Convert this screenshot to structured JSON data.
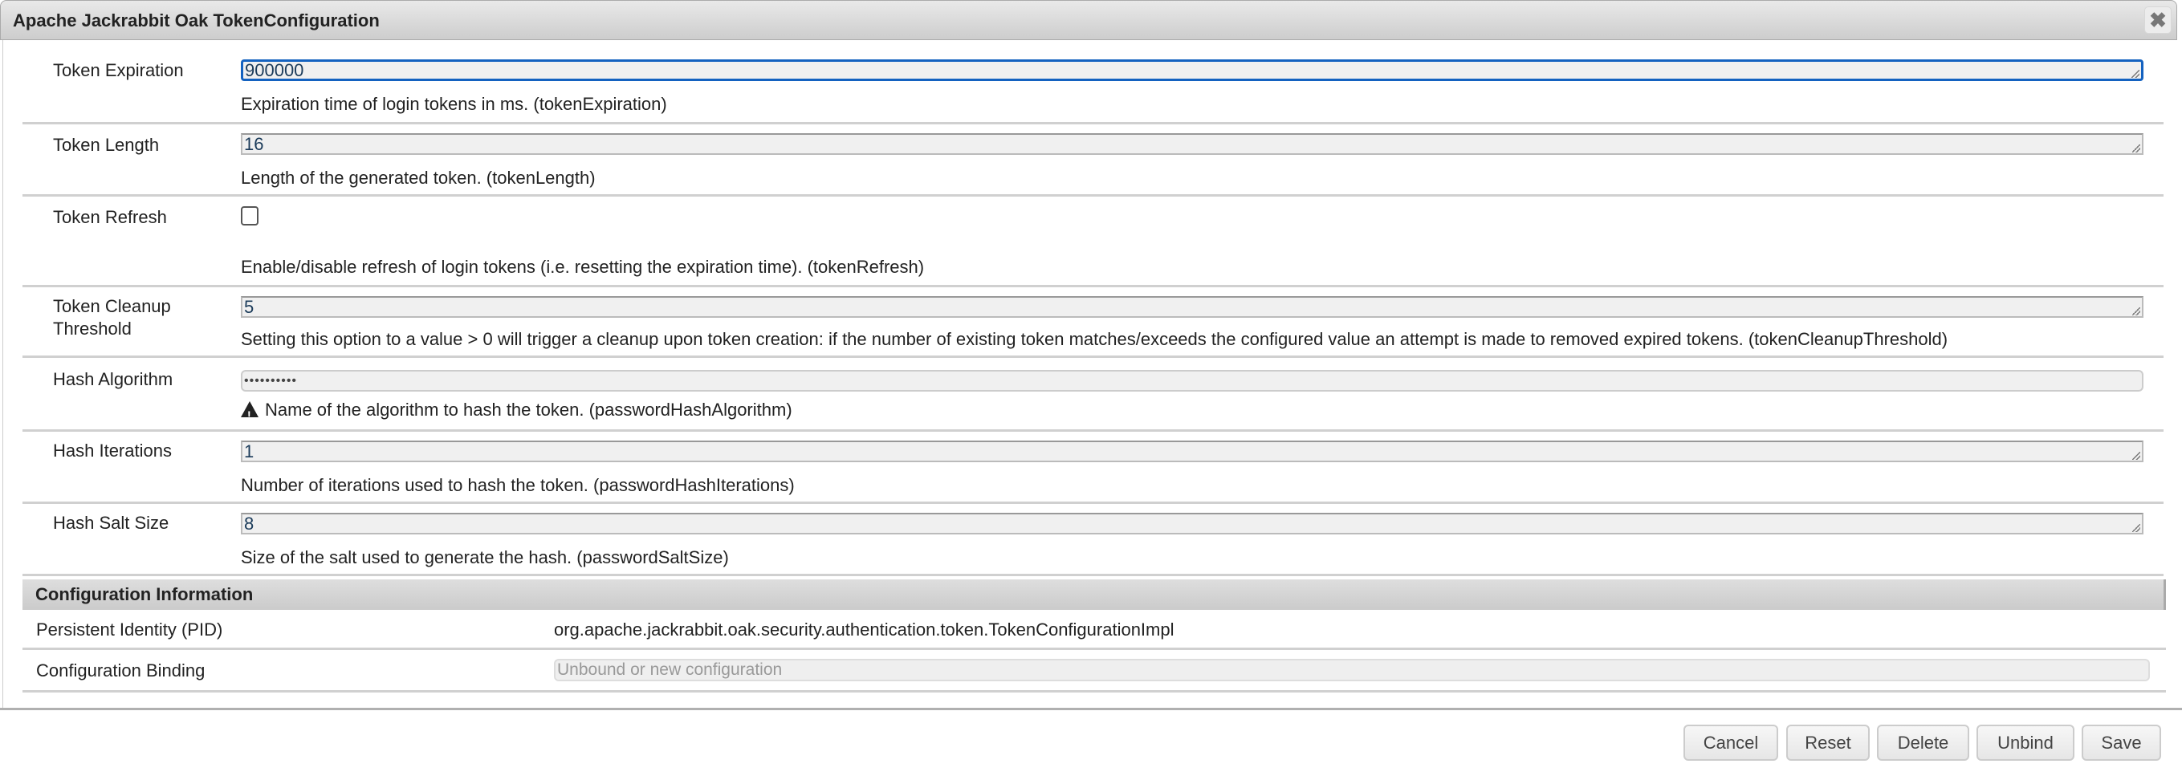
{
  "dialog": {
    "title": "Apache Jackrabbit Oak TokenConfiguration",
    "close_icon": "close-icon"
  },
  "fields": [
    {
      "label": "Token Expiration",
      "value": "900000",
      "description": "Expiration time of login tokens in ms. (tokenExpiration)"
    },
    {
      "label": "Token Length",
      "value": "16",
      "description": "Length of the generated token. (tokenLength)"
    },
    {
      "label": "Token Refresh",
      "checked": false,
      "description": "Enable/disable refresh of login tokens (i.e. resetting the expiration time). (tokenRefresh)"
    },
    {
      "label_line1": "Token Cleanup",
      "label_line2": "Threshold",
      "value": "5",
      "description": "Setting this option to a value > 0 will trigger a cleanup upon token creation: if the number of existing token matches/exceeds the configured value an attempt is made to removed expired tokens. (tokenCleanupThreshold)"
    },
    {
      "label": "Hash Algorithm",
      "value": "••••••••••",
      "description": "Name of the algorithm to hash the token. (passwordHashAlgorithm)",
      "icon": "warning-icon"
    },
    {
      "label": "Hash Iterations",
      "value": "1",
      "description": "Number of iterations used to hash the token. (passwordHashIterations)"
    },
    {
      "label": "Hash Salt Size",
      "value": "8",
      "description": "Size of the salt used to generate the hash. (passwordSaltSize)"
    }
  ],
  "config_info": {
    "heading": "Configuration Information",
    "pid_label": "Persistent Identity (PID)",
    "pid_value": "org.apache.jackrabbit.oak.security.authentication.token.TokenConfigurationImpl",
    "binding_label": "Configuration Binding",
    "binding_placeholder": "Unbound or new configuration"
  },
  "buttons": {
    "cancel": "Cancel",
    "reset": "Reset",
    "delete": "Delete",
    "unbind": "Unbind",
    "save": "Save"
  },
  "colors": {
    "focus": "#1462c0"
  }
}
